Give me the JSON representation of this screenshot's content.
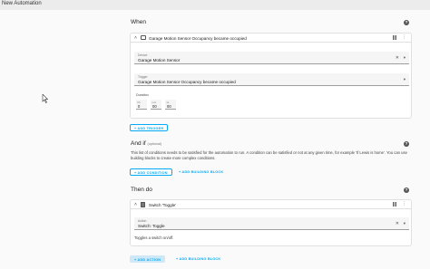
{
  "window": {
    "title": "New Automation"
  },
  "when": {
    "title": "When",
    "trigger": {
      "title": "Garage Motion Sensor Occupancy became occupied",
      "device_label": "Device",
      "device_value": "Garage Motion Sensor",
      "trigger_label": "Trigger",
      "trigger_value": "Garage Motion Sensor Occupancy became occupied",
      "duration_label": "Duration",
      "units": {
        "hh": "hh",
        "mm": "mm",
        "ss": "ss"
      },
      "values": {
        "hh": "0",
        "mm": "00",
        "ss": "00"
      }
    },
    "add_trigger_label": "ADD TRIGGER"
  },
  "and_if": {
    "title": "And if",
    "optional": "(optional)",
    "description": "This list of conditions needs to be satisfied for the automation to run. A condition can be satisfied or not at any given time, for example 'If Lewis is home'. You can use building blocks to create more complex conditions.",
    "add_condition_label": "ADD CONDITION",
    "add_building_block_label": "ADD BUILDING BLOCK"
  },
  "then_do": {
    "title": "Then do",
    "action": {
      "title": "Switch 'Toggle'",
      "action_label": "Action",
      "action_value": "Switch: Toggle",
      "description": "Toggles a switch on/off."
    },
    "add_action_label": "ADD ACTION",
    "add_building_block_label": "ADD BUILDING BLOCK"
  },
  "icons": {
    "help": "help-circle-icon",
    "chevron": "chevron-up-icon",
    "drag": "drag-handle-icon",
    "menu": "more-vertical-icon",
    "clear": "close-icon",
    "dropdown": "dropdown-arrow-icon"
  },
  "colors": {
    "accent": "#03a9f4",
    "background": "#fafafa",
    "card": "#ffffff"
  }
}
